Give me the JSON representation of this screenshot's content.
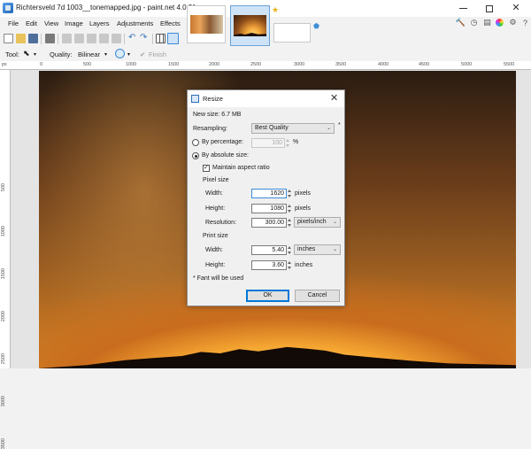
{
  "window": {
    "title": "Richtersveld 7d 1003__tonemapped.jpg - paint.net 4.0.21"
  },
  "menu": [
    "File",
    "Edit",
    "View",
    "Image",
    "Layers",
    "Adjustments",
    "Effects"
  ],
  "tool_options": {
    "tool_label": "Tool:",
    "quality_label": "Quality:",
    "quality_value": "Bilinear",
    "finish_label": "Finish"
  },
  "ruler": {
    "unit": "px",
    "top_labels": [
      "0",
      "500",
      "1000",
      "1500",
      "2000",
      "2500",
      "3000",
      "3500",
      "4000",
      "4500",
      "5000",
      "5500"
    ],
    "left_labels": [
      "500",
      "1000",
      "1500",
      "2000",
      "2500",
      "3000",
      "3500"
    ]
  },
  "dialog": {
    "title": "Resize",
    "new_size": "New size: 6.7 MB",
    "resampling_label": "Resampling:",
    "resampling_value": "Best Quality",
    "resampling_marker": "*",
    "by_percentage_label": "By percentage:",
    "percentage_value": "100",
    "percent_sign": "%",
    "by_absolute_label": "By absolute size:",
    "maintain_aspect_label": "Maintain aspect ratio",
    "pixel_size_label": "Pixel size",
    "pixel_width_label": "Width:",
    "pixel_width_value": "1620",
    "pixel_width_unit": "pixels",
    "pixel_height_label": "Height:",
    "pixel_height_value": "1080",
    "pixel_height_unit": "pixels",
    "resolution_label": "Resolution:",
    "resolution_value": "300.00",
    "resolution_unit": "pixels/inch",
    "print_size_label": "Print size",
    "print_width_label": "Width:",
    "print_width_value": "5.40",
    "print_width_unit": "inches",
    "print_height_label": "Height:",
    "print_height_value": "3.60",
    "print_height_unit": "inches",
    "footnote": "* Fant will be used",
    "ok_label": "OK",
    "cancel_label": "Cancel"
  },
  "colors": {
    "accent": "#0078d7",
    "star": "#e9b217"
  }
}
